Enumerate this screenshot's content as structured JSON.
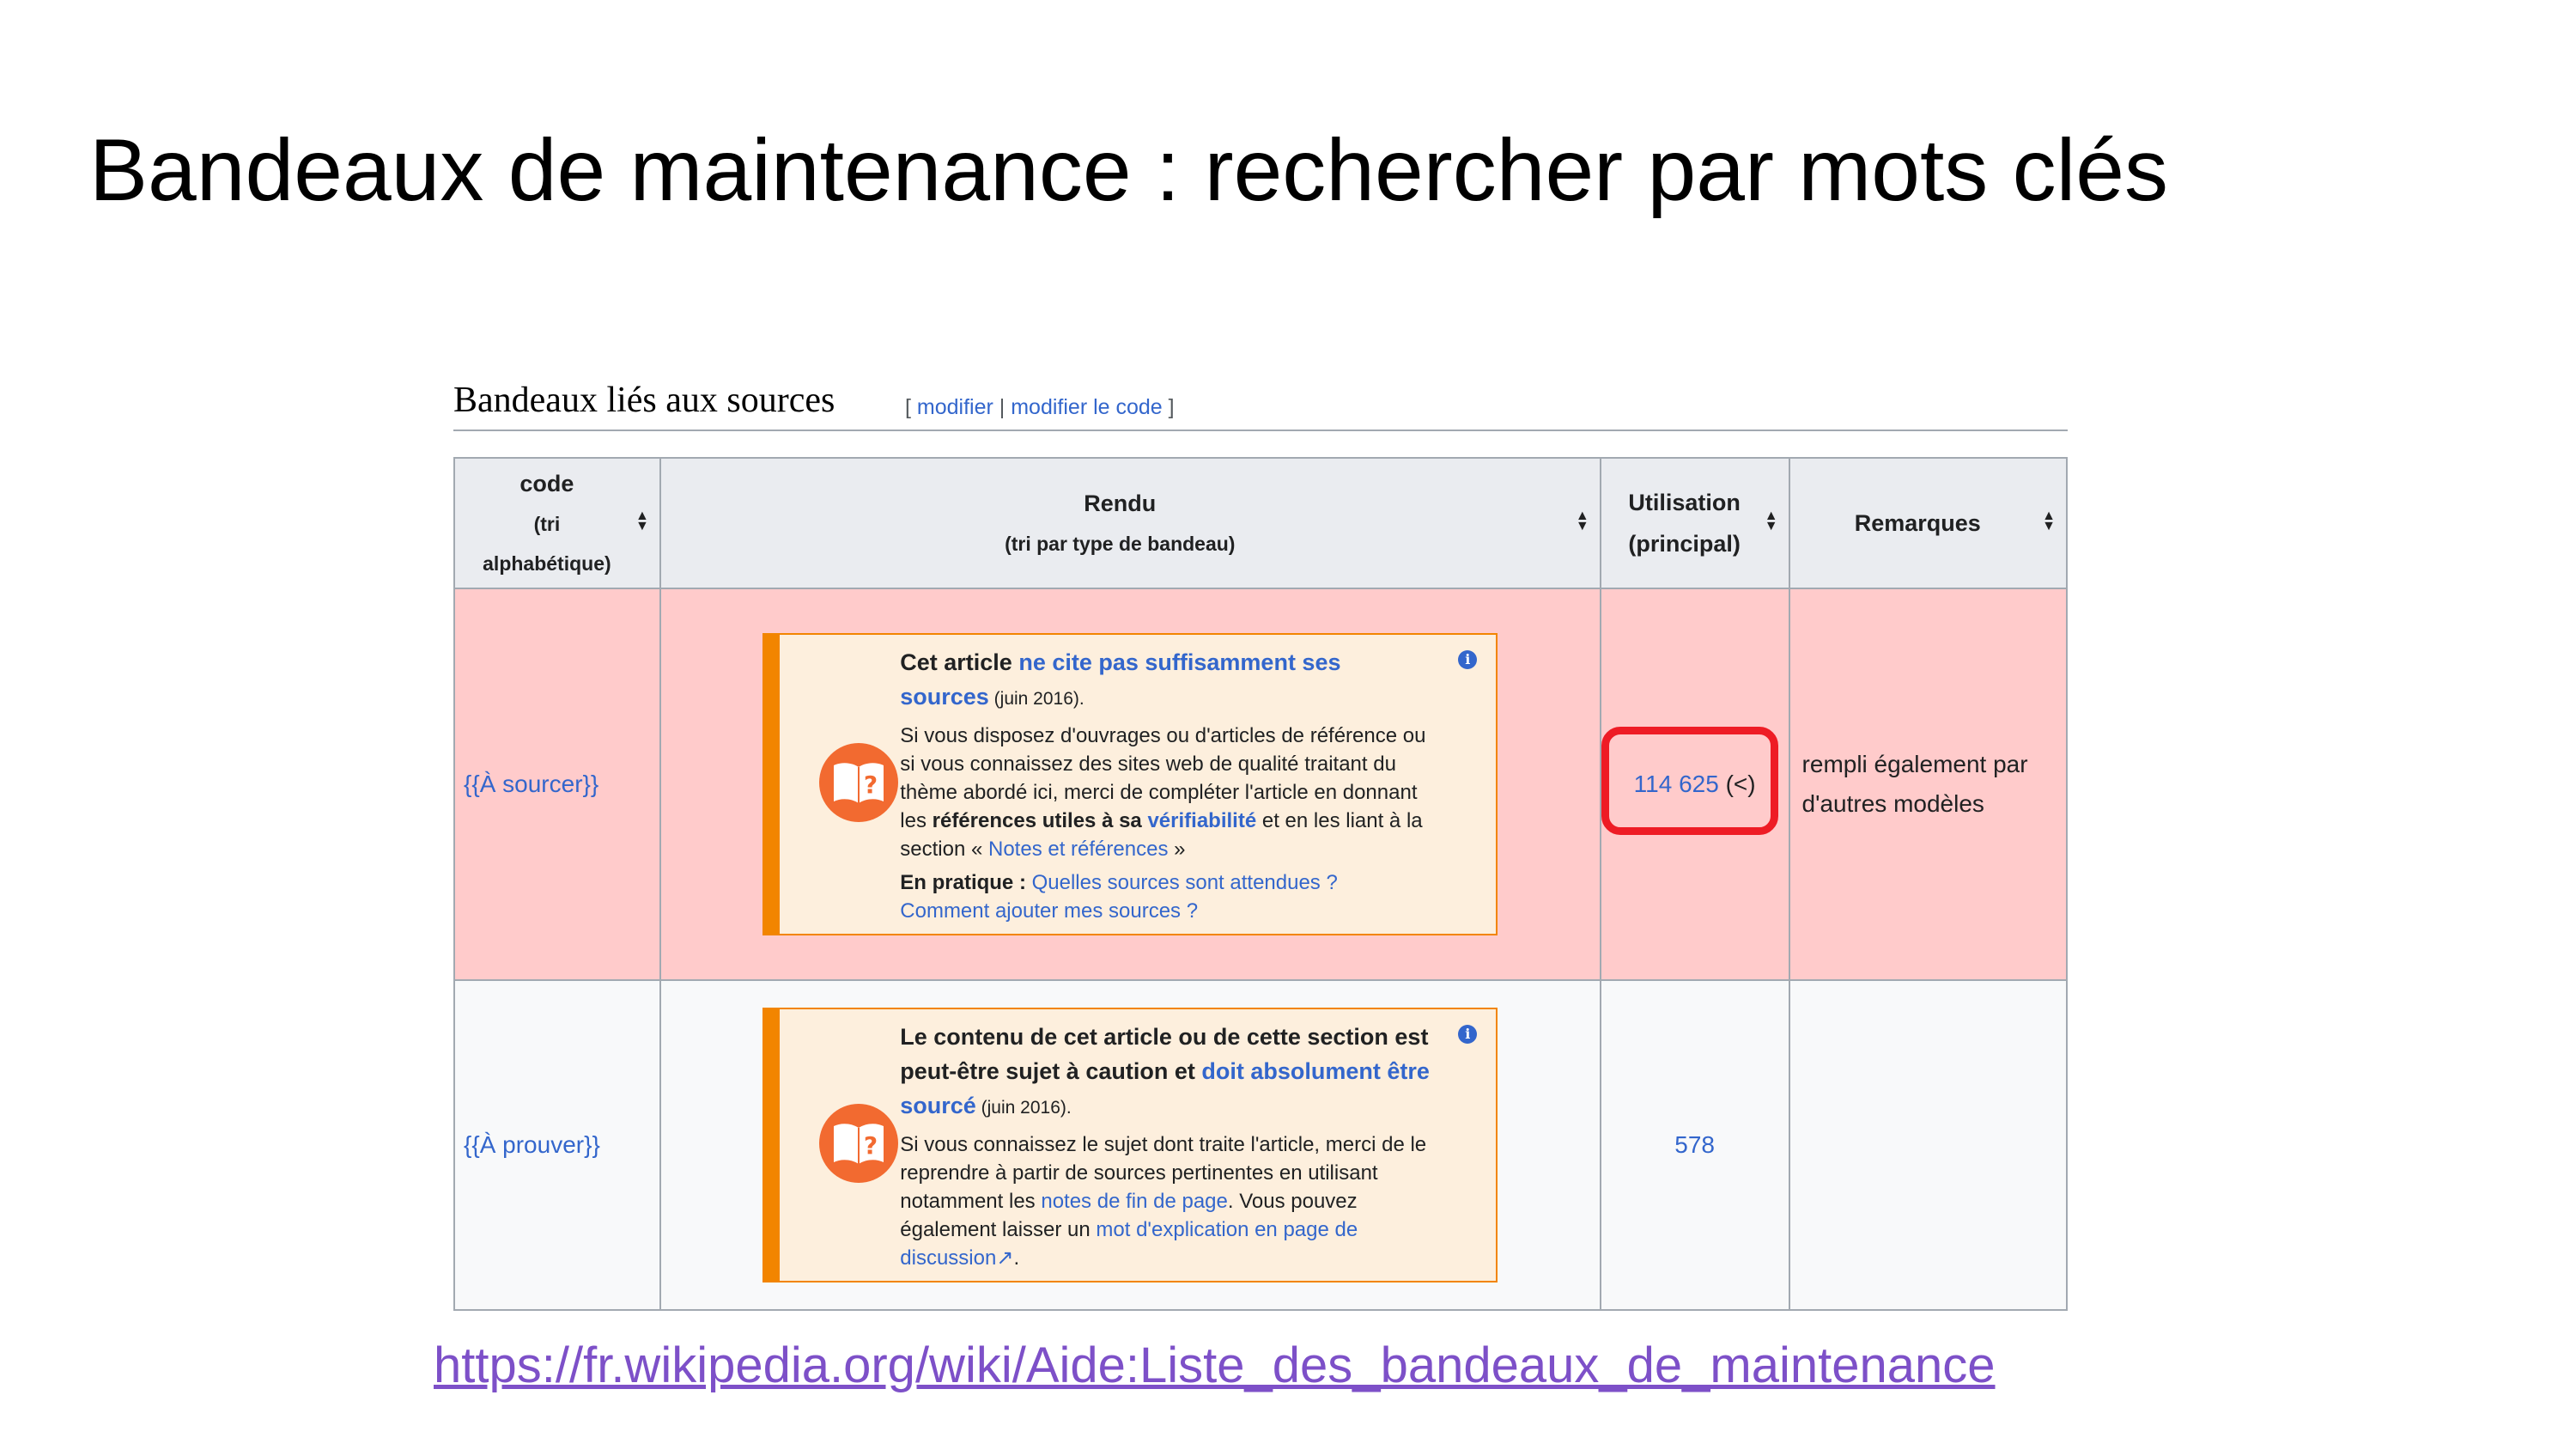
{
  "slide": {
    "title": "Bandeaux de maintenance : rechercher par mots clés",
    "url": "https://fr.wikipedia.org/wiki/Aide:Liste_des_bandeaux_de_maintenance"
  },
  "section": {
    "heading": "Bandeaux liés aux sources",
    "edit_open": "[",
    "edit_label": "modifier",
    "edit_sep": "|",
    "edit_code_label": "modifier le code",
    "edit_close": "]"
  },
  "table": {
    "headers": {
      "code": "code",
      "code_sub1": "(tri",
      "code_sub2": "alphabétique)",
      "rendu": "Rendu",
      "rendu_sub": "(tri par type de bandeau)",
      "util1": "Utilisation",
      "util2": "(principal)",
      "remarques": "Remarques"
    },
    "sort_icon": "sort-arrows-icon",
    "rows": [
      {
        "code": "{{À sourcer}}",
        "banner": {
          "lead_a": "Cet article ",
          "lead_link": "ne cite pas suffisamment ses sources",
          "date": " (juin 2016).",
          "p1_a": "Si vous disposez d'ouvrages ou d'articles de référence ou si vous connaissez des sites web de qualité traitant du thème abordé ici, merci de compléter l'article en donnant les ",
          "p1_b": "références utiles à sa ",
          "p1_link": "vérifiabilité",
          "p1_c": " et en les liant à la section « ",
          "p1_link2": "Notes et références",
          "p1_d": " »",
          "p2_label": "En pratique : ",
          "p2_link1": "Quelles sources sont attendues ?",
          "p2_link2": "Comment ajouter mes sources ?"
        },
        "usage": "114 625",
        "usage_extra": "(<)",
        "remarks": "rempli également par d'autres modèles"
      },
      {
        "code": "{{À prouver}}",
        "banner": {
          "lead_a": "Le contenu de cet article ou de cette section est peut-être sujet à caution et ",
          "lead_link": "doit absolument être sourcé",
          "date": " (juin 2016).",
          "p1_a": "Si vous connaissez le sujet dont traite l'article, merci de le reprendre à partir de sources pertinentes en utilisant notamment les ",
          "p1_link": "notes de fin de page",
          "p1_b": ". Vous pouvez également laisser un ",
          "p1_link2": "mot d'explication en page de discussion",
          "p1_c": "."
        },
        "usage": "578",
        "remarks": ""
      }
    ]
  },
  "colors": {
    "row_highlight": "#ffcbcb",
    "banner_border": "#f28500",
    "banner_bg": "#fdefdd",
    "icon_bg": "#f26a30",
    "link": "#3366cc",
    "callout": "#ee1c25",
    "url": "#7d50c8"
  }
}
